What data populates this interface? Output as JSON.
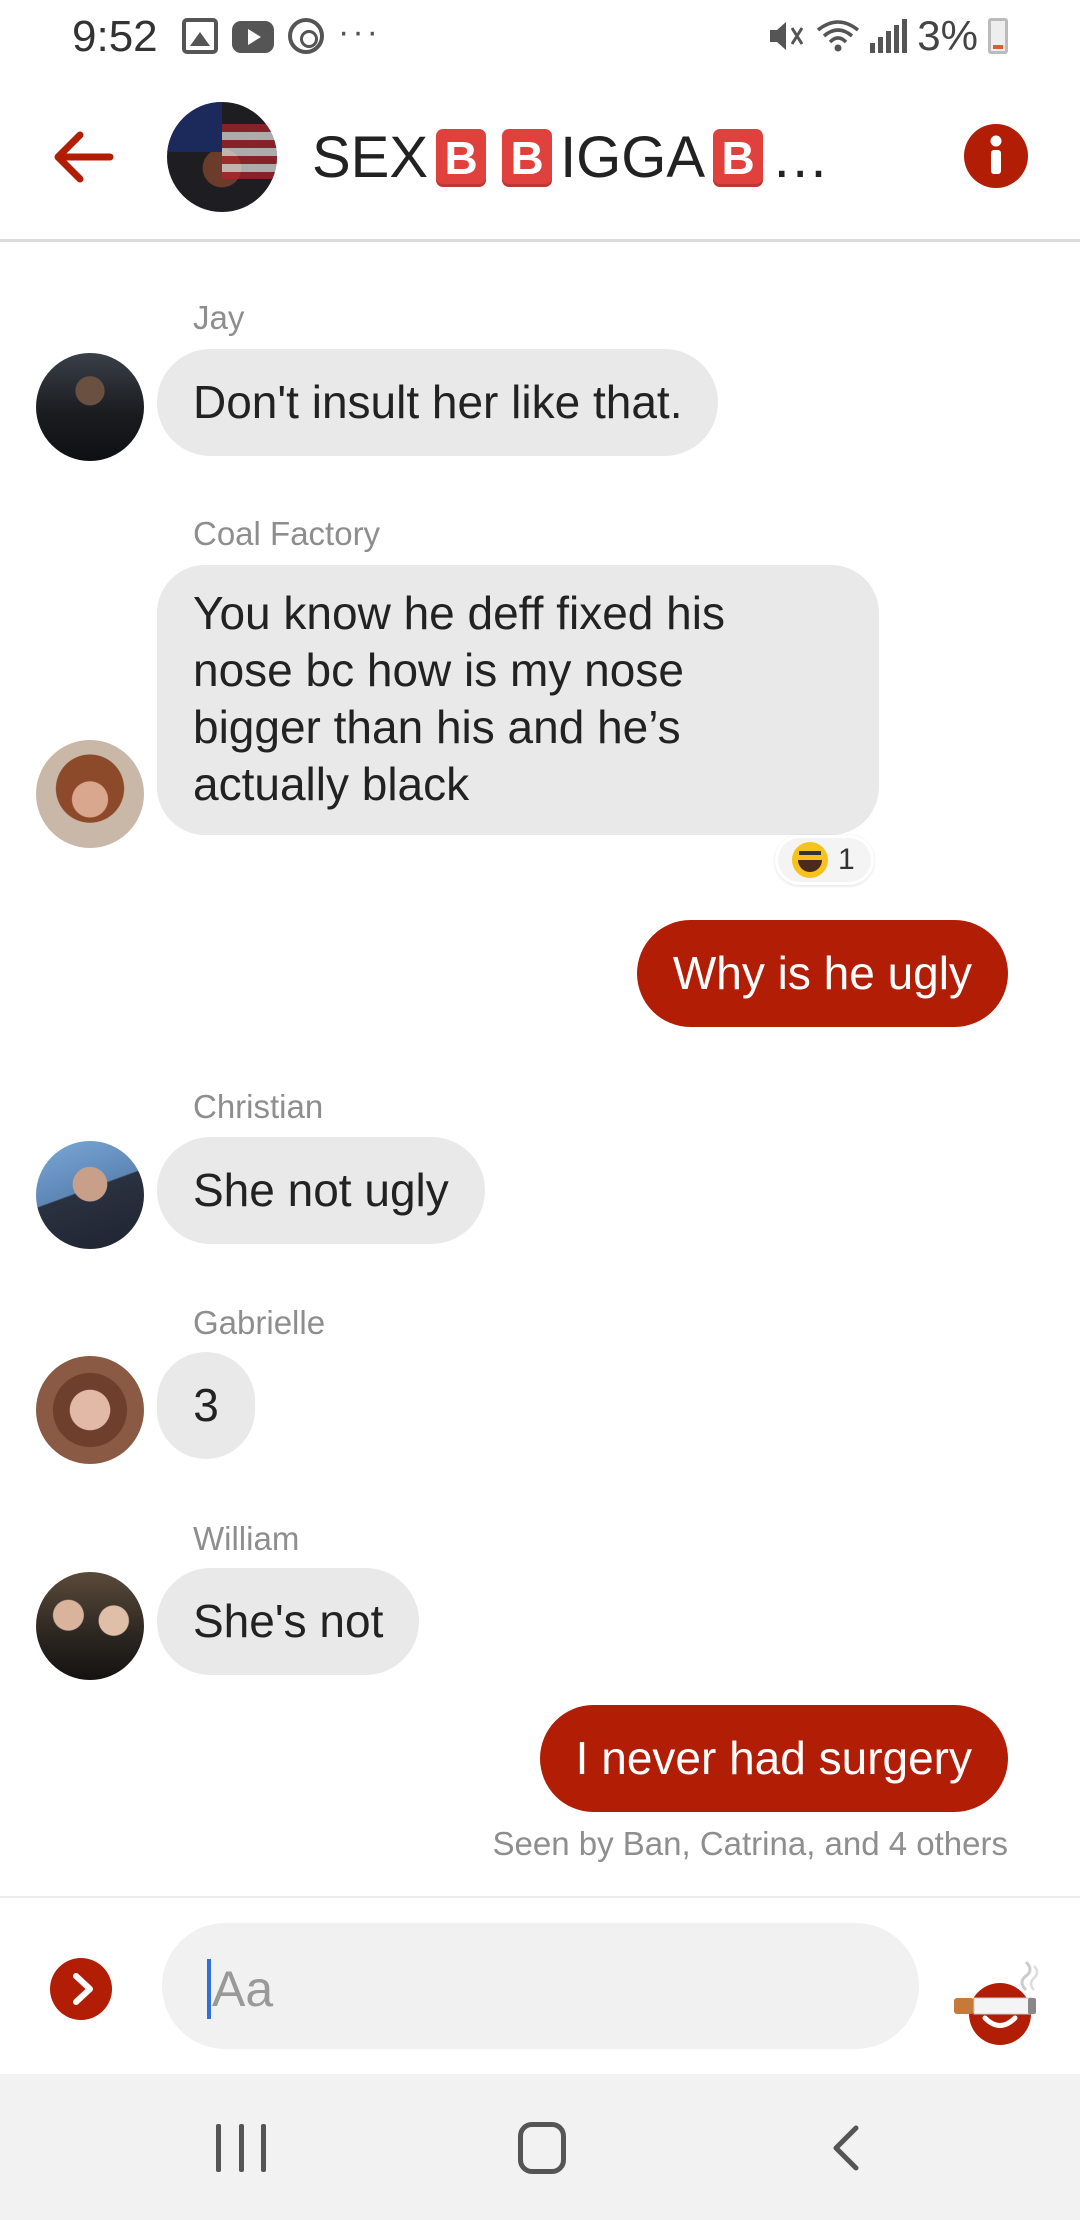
{
  "status_bar": {
    "time": "9:52",
    "overflow": "···",
    "battery_percent": "3%",
    "icons": [
      "image-icon",
      "youtube-icon",
      "sync-icon",
      "mute-icon",
      "wifi-icon",
      "signal-icon",
      "battery-icon"
    ]
  },
  "header": {
    "title_parts": [
      "SEX",
      "B",
      "B",
      "IGGA",
      "B",
      "…"
    ],
    "icons": [
      "back-arrow-icon",
      "info-icon"
    ],
    "accent_color": "#b21d05"
  },
  "messages": [
    {
      "sender": "Jay",
      "text": "Don't insult her like that.",
      "direction": "in"
    },
    {
      "sender": "Coal Factory",
      "text_lines": [
        "You know he deff fixed his",
        "nose bc how is my nose",
        "bigger than his and he’s",
        "actually black"
      ],
      "direction": "in",
      "reaction": {
        "emoji": "laughing-emoji",
        "count": "1"
      }
    },
    {
      "text": "Why is he ugly",
      "direction": "out"
    },
    {
      "sender": "Christian",
      "text": "She not ugly",
      "direction": "in"
    },
    {
      "sender": "Gabrielle",
      "text": "3",
      "direction": "in"
    },
    {
      "sender": "William",
      "text": "She's not",
      "direction": "in"
    },
    {
      "text": "I never had surgery",
      "direction": "out"
    }
  ],
  "seen_text": "Seen by Ban, Catrina, and 4 others",
  "composer": {
    "placeholder": "Aa",
    "icons": [
      "expand-icon",
      "emoji-icon",
      "cigarette-icon"
    ]
  },
  "nav_bar": {
    "icons": [
      "recents-icon",
      "home-icon",
      "back-icon"
    ]
  }
}
